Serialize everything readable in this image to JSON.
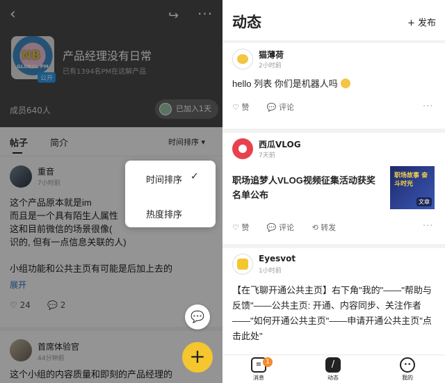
{
  "left": {
    "header": {
      "back_icon": "chevron-left-icon",
      "share_icon": "share-icon",
      "more_icon": "more-dots-icon",
      "avatar_text": "NB",
      "avatar_subtext": "GLOBAL PM",
      "public_badge": "公开",
      "group_name": "产品经理没有日常",
      "group_sub": "已有1394名PM在这解产品",
      "member_count": "成员640人",
      "joined_label": "已加入1天"
    },
    "tabs": {
      "posts": "帖子",
      "intro": "简介",
      "sort": "时间排序 ▾"
    },
    "post1": {
      "author": "重音",
      "time": "7小时前",
      "body": "这个产品原本就是im\n而且是一个具有陌生人属性\n这和目前微信的场景很像(\n识的, 但有一点信息关联的人)\n\n小组功能和公共主页有可能是后加上去的",
      "expand": "展开",
      "likes": "♡ 24",
      "comments": "💬 2"
    },
    "post2": {
      "author": "首席体验官",
      "time": "44分钟前",
      "body": "这个小组的内容质量和即刻的产品经理的"
    },
    "sort_menu": {
      "option1": "时间排序",
      "option1_check": "✓",
      "option2": "热度排序"
    },
    "fab_add": "+",
    "fab_msg": "💬"
  },
  "right": {
    "title": "动态",
    "publish": "+ 发布",
    "card1": {
      "author": "猫薄荷",
      "time": "2小时前",
      "text": "hello 列表 你们是机器人吗",
      "like": "♡ 赞",
      "comment": "💬 评论",
      "more": "···"
    },
    "card2": {
      "author": "西瓜VLOG",
      "time": "7天前",
      "text": "职场追梦人VLOG视频征集活动获奖名单公布",
      "thumb_text": "职场故事 奋斗时光",
      "thumb_tag": "文章",
      "like": "♡ 赞",
      "comment": "💬 评论",
      "repost": "⟲ 转发",
      "more": "···"
    },
    "card3": {
      "author": "Eyesvot",
      "time": "1小时前",
      "text": "【在飞聊开通公共主页】右下角\"我的\"——\"帮助与反馈\"——公共主页: 开通、内容同步、关注作者——\"如何开通公共主页\"——申请开通公共主页\"点击此处\""
    },
    "tabbar": {
      "messages": "消息",
      "messages_badge": "1",
      "feed": "动态",
      "mine": "我的"
    }
  },
  "colors": {
    "accent_yellow": "#f5c62e",
    "link_blue": "#2a74c6",
    "badge_orange": "#f58a2e"
  }
}
